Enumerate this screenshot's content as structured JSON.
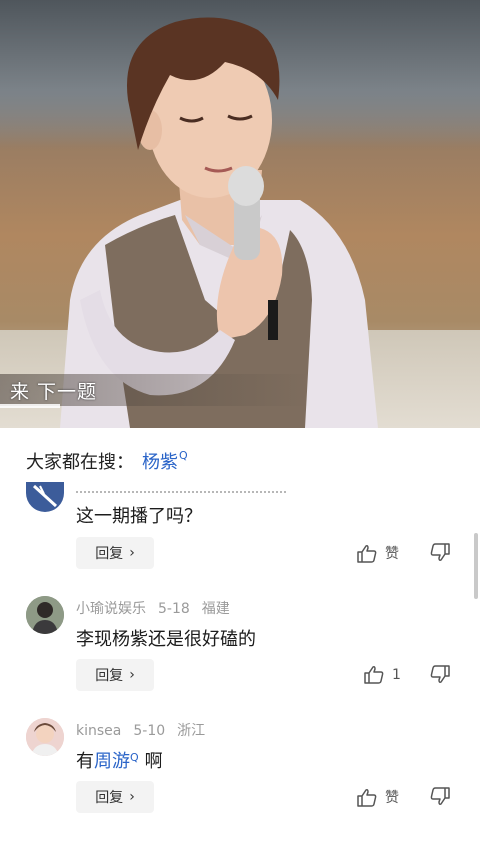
{
  "video": {
    "subtitle": "来 下一题"
  },
  "search": {
    "label": "大家都在搜：",
    "term": "杨紫",
    "mark": "Q"
  },
  "comments": [
    {
      "user": "",
      "date": "",
      "location": "",
      "text": "这一期播了吗？",
      "reply_label": "回复",
      "like_label": "赞"
    },
    {
      "user": "小瑜说娱乐",
      "date": "5-18",
      "location": "福建",
      "text": "李现杨紫还是很好磕的",
      "reply_label": "回复",
      "like_label": "1"
    },
    {
      "user": "kinsea",
      "date": "5-10",
      "location": "浙江",
      "text_prefix": "有",
      "text_link": "周游",
      "text_link_mark": "Q",
      "text_suffix": "啊",
      "reply_label": "回复",
      "like_label": "赞"
    }
  ],
  "icons": {
    "like": "thumbs-up-icon",
    "dislike": "thumbs-down-icon",
    "reply_chevron": "chevron-right-icon"
  },
  "colors": {
    "link": "#2a64c8",
    "meta": "#9a9a9a",
    "reply_bg": "#f3f3f3"
  }
}
